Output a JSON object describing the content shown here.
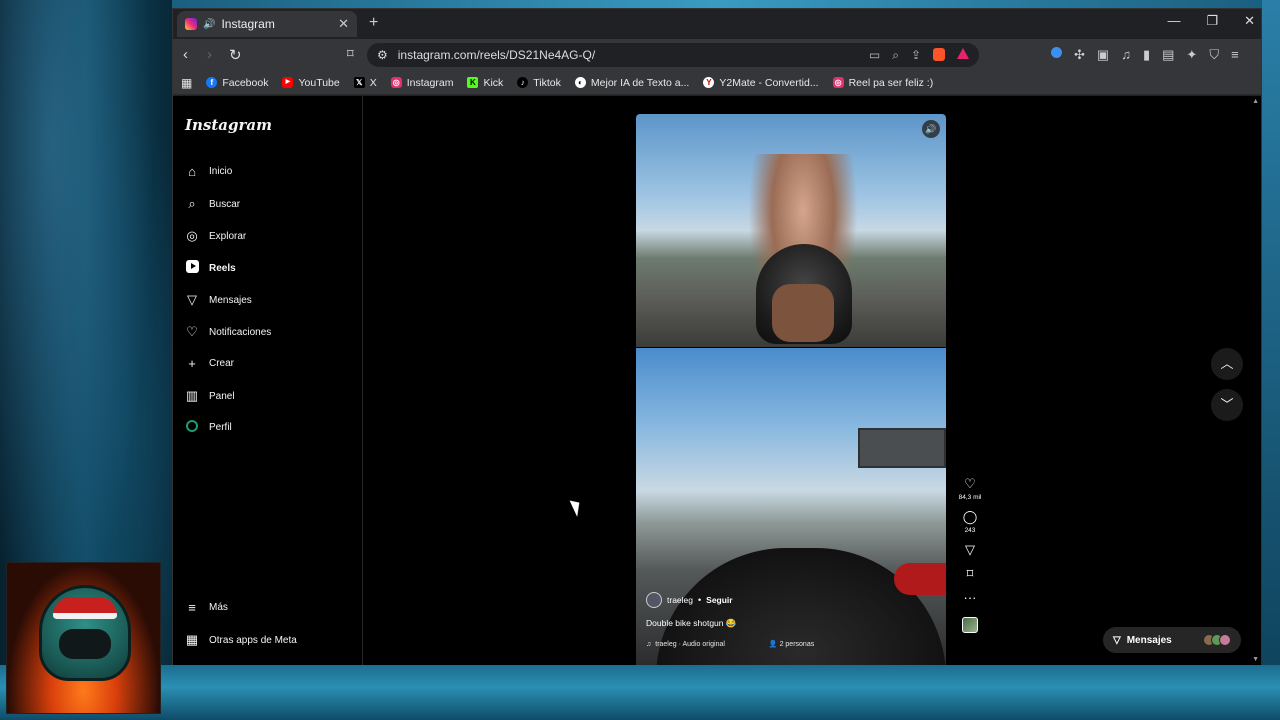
{
  "browser": {
    "tab_title": "Instagram",
    "tab_close": "✕",
    "new_tab": "+",
    "url": "instagram.com/reels/DS21Ne4AG-Q/",
    "window_controls": [
      "—",
      "❐",
      "✕"
    ]
  },
  "bookmarks": [
    {
      "label": "Facebook",
      "color": "#1877f2",
      "glyph": "f"
    },
    {
      "label": "YouTube",
      "color": "#ff0000",
      "glyph": "▶"
    },
    {
      "label": "X",
      "color": "#000000",
      "glyph": "𝕏"
    },
    {
      "label": "Instagram",
      "color": "#e1306c",
      "glyph": "◎"
    },
    {
      "label": "Kick",
      "color": "#53fc18",
      "glyph": "K"
    },
    {
      "label": "Tiktok",
      "color": "#000000",
      "glyph": "♪"
    },
    {
      "label": "Mejor IA de Texto a...",
      "color": "#ffffff",
      "glyph": "◐"
    },
    {
      "label": "Y2Mate - Convertid...",
      "color": "#ffffff",
      "glyph": "Y"
    },
    {
      "label": "Reel pa ser feliz :)",
      "color": "#e1306c",
      "glyph": "◎"
    }
  ],
  "sidebar": {
    "wordmark": "Instagram",
    "items": [
      {
        "label": "Inicio",
        "icon": "⌂"
      },
      {
        "label": "Buscar",
        "icon": "⌕"
      },
      {
        "label": "Explorar",
        "icon": "◎"
      },
      {
        "label": "Reels",
        "icon": "reels"
      },
      {
        "label": "Mensajes",
        "icon": "▽"
      },
      {
        "label": "Notificaciones",
        "icon": "♡"
      },
      {
        "label": "Crear",
        "icon": "+"
      },
      {
        "label": "Panel",
        "icon": "▥"
      },
      {
        "label": "Perfil",
        "icon": "profile"
      }
    ],
    "more_label": "Más",
    "meta_label": "Otras apps de Meta"
  },
  "reel": {
    "author": "traeleg",
    "separator": "•",
    "follow_label": "Seguir",
    "caption": "Double bike shotgun 😂",
    "audio": "traeleg · Audio original",
    "people": "2 personas",
    "likes": "84,3 mil",
    "comments": "243",
    "more": "···"
  },
  "messages_pill": {
    "label": "Mensajes"
  },
  "colors": {
    "page_bg": "#000000",
    "pill_bg": "#262626",
    "chrome_bg": "#35363a"
  }
}
